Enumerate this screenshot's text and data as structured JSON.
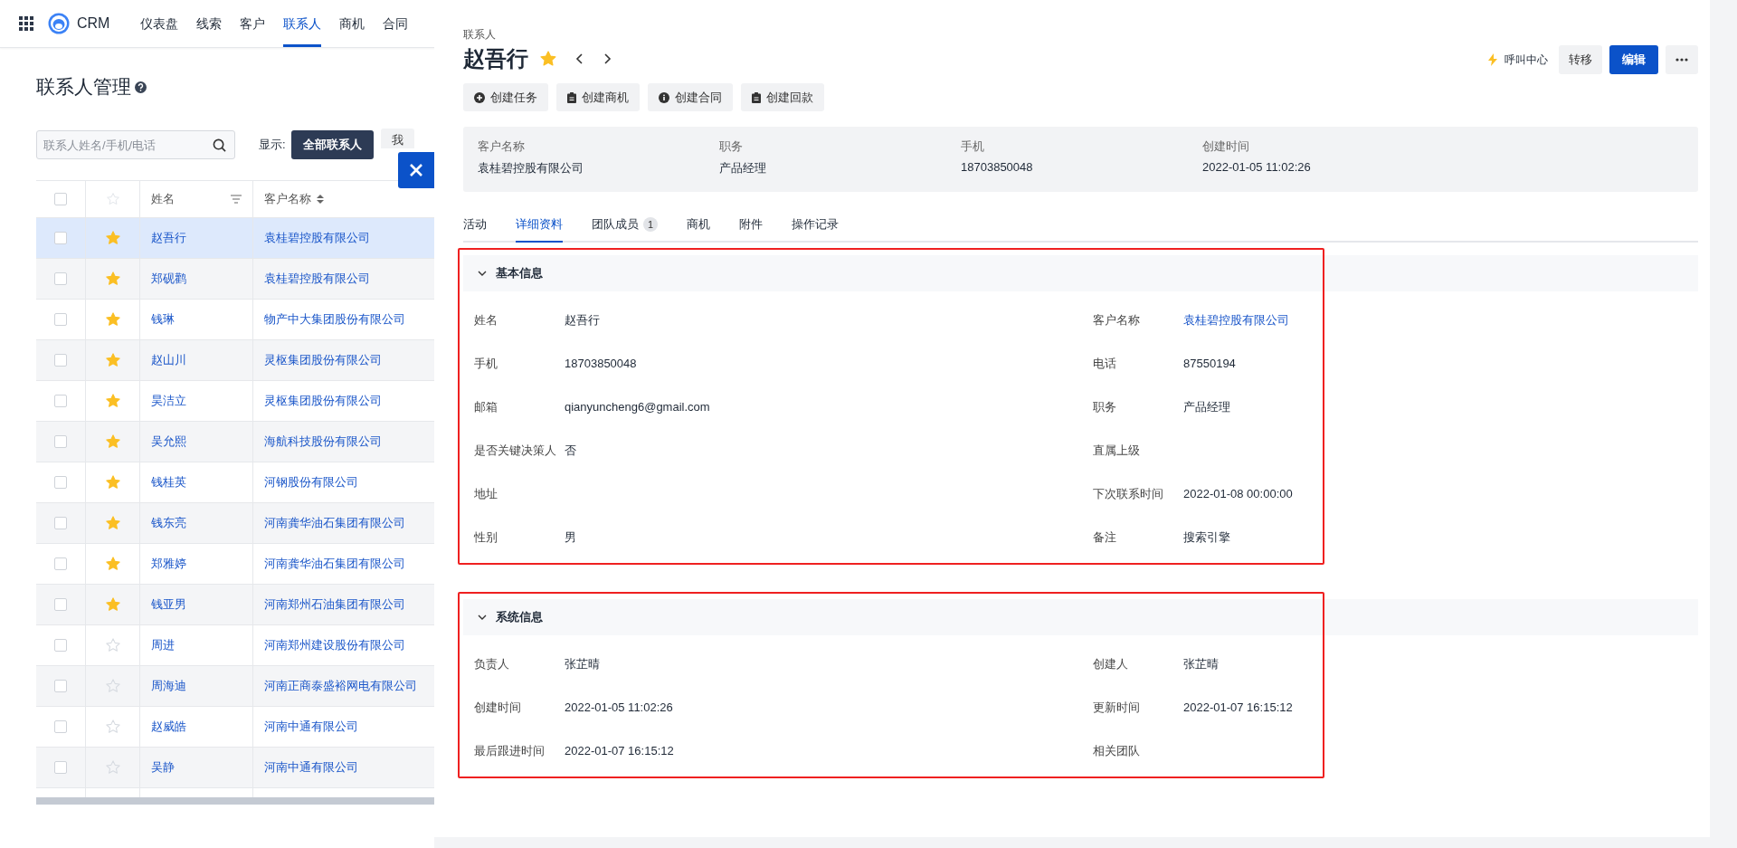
{
  "nav": {
    "brand": "CRM",
    "items": [
      {
        "label": "仪表盘",
        "selected": false
      },
      {
        "label": "线索",
        "selected": false
      },
      {
        "label": "客户",
        "selected": false
      },
      {
        "label": "联系人",
        "selected": true
      },
      {
        "label": "商机",
        "selected": false
      },
      {
        "label": "合同",
        "selected": false
      }
    ]
  },
  "page": {
    "title": "联系人管理",
    "search": {
      "placeholder": "联系人姓名/手机/电话"
    },
    "filter_label": "显示:",
    "filters": [
      {
        "label": "全部联系人",
        "selected": true
      },
      {
        "label": "我",
        "selected": false
      }
    ]
  },
  "table": {
    "columns": [
      "姓名",
      "客户名称"
    ],
    "all_checked": false,
    "rows": [
      {
        "starred": true,
        "selected": true,
        "name": "赵吾行",
        "customer": "袁桂碧控股有限公司"
      },
      {
        "starred": true,
        "selected": false,
        "name": "郑砚鹳",
        "customer": "袁桂碧控股有限公司"
      },
      {
        "starred": true,
        "selected": false,
        "name": "钱琳",
        "customer": "物产中大集团股份有限公司"
      },
      {
        "starred": true,
        "selected": false,
        "name": "赵山川",
        "customer": "灵枢集团股份有限公司"
      },
      {
        "starred": true,
        "selected": false,
        "name": "昊洁立",
        "customer": "灵枢集团股份有限公司"
      },
      {
        "starred": true,
        "selected": false,
        "name": "吴允熙",
        "customer": "海航科技股份有限公司"
      },
      {
        "starred": true,
        "selected": false,
        "name": "钱桂英",
        "customer": "河钢股份有限公司"
      },
      {
        "starred": true,
        "selected": false,
        "name": "钱东亮",
        "customer": "河南龚华油石集团有限公司"
      },
      {
        "starred": true,
        "selected": false,
        "name": "郑雅婷",
        "customer": "河南龚华油石集团有限公司"
      },
      {
        "starred": true,
        "selected": false,
        "name": "钱亚男",
        "customer": "河南郑州石油集团有限公司"
      },
      {
        "starred": false,
        "selected": false,
        "name": "周进",
        "customer": "河南郑州建设股份有限公司"
      },
      {
        "starred": false,
        "selected": false,
        "name": "周海迪",
        "customer": "河南正商泰盛裕网电有限公司"
      },
      {
        "starred": false,
        "selected": false,
        "name": "赵威皓",
        "customer": "河南中通有限公司"
      },
      {
        "starred": false,
        "selected": false,
        "name": "吴静",
        "customer": "河南中通有限公司"
      }
    ]
  },
  "drawer": {
    "breadcrumb": "联系人",
    "title": "赵吾行",
    "starred": true,
    "call_center": "呼叫中心",
    "buttons": [
      {
        "label": "转移",
        "kind": "default"
      },
      {
        "label": "编辑",
        "kind": "primary"
      }
    ],
    "actions": [
      {
        "label": "创建任务",
        "kind": "plus"
      },
      {
        "label": "创建商机",
        "kind": "clipboard"
      },
      {
        "label": "创建合同",
        "kind": "info"
      },
      {
        "label": "创建回款",
        "kind": "clipboard"
      }
    ],
    "summary": [
      {
        "label": "客户名称",
        "value": "袁桂碧控股有限公司"
      },
      {
        "label": "职务",
        "value": "产品经理"
      },
      {
        "label": "手机",
        "value": "18703850048"
      },
      {
        "label": "创建时间",
        "value": "2022-01-05 11:02:26"
      }
    ],
    "tabs": [
      {
        "label": "活动",
        "selected": false
      },
      {
        "label": "详细资料",
        "selected": true
      },
      {
        "label": "团队成员",
        "selected": false,
        "badge": "1"
      },
      {
        "label": "商机",
        "selected": false
      },
      {
        "label": "附件",
        "selected": false
      },
      {
        "label": "操作记录",
        "selected": false
      }
    ],
    "sections": [
      {
        "title": "基本信息",
        "expanded": true,
        "highlighted": true,
        "fields": [
          {
            "label": "姓名",
            "value": "赵吾行",
            "kind": "text"
          },
          {
            "label": "客户名称",
            "value": "袁桂碧控股有限公司",
            "kind": "link"
          },
          {
            "label": "手机",
            "value": "18703850048",
            "kind": "text"
          },
          {
            "label": "电话",
            "value": "87550194",
            "kind": "text"
          },
          {
            "label": "邮箱",
            "value": "qianyuncheng6@gmail.com",
            "kind": "text"
          },
          {
            "label": "职务",
            "value": "产品经理",
            "kind": "text"
          },
          {
            "label": "是否关键决策人",
            "value": "否",
            "kind": "text"
          },
          {
            "label": "直属上级"
          },
          {
            "label": "地址"
          },
          {
            "label": "下次联系时间",
            "value": "2022-01-08 00:00:00",
            "kind": "text"
          },
          {
            "label": "性别",
            "value": "男",
            "kind": "text"
          },
          {
            "label": "备注",
            "value": "搜索引擎",
            "kind": "text"
          }
        ]
      },
      {
        "title": "系统信息",
        "expanded": true,
        "highlighted": true,
        "fields": [
          {
            "label": "负责人",
            "value": "张芷晴",
            "kind": "text"
          },
          {
            "label": "创建人",
            "value": "张芷晴",
            "kind": "text"
          },
          {
            "label": "创建时间",
            "value": "2022-01-05 11:02:26",
            "kind": "text"
          },
          {
            "label": "更新时间",
            "value": "2022-01-07 16:15:12",
            "kind": "text"
          },
          {
            "label": "最后跟进时间",
            "value": "2022-01-07 16:15:12",
            "kind": "text"
          },
          {
            "label": "相关团队"
          }
        ]
      }
    ]
  }
}
